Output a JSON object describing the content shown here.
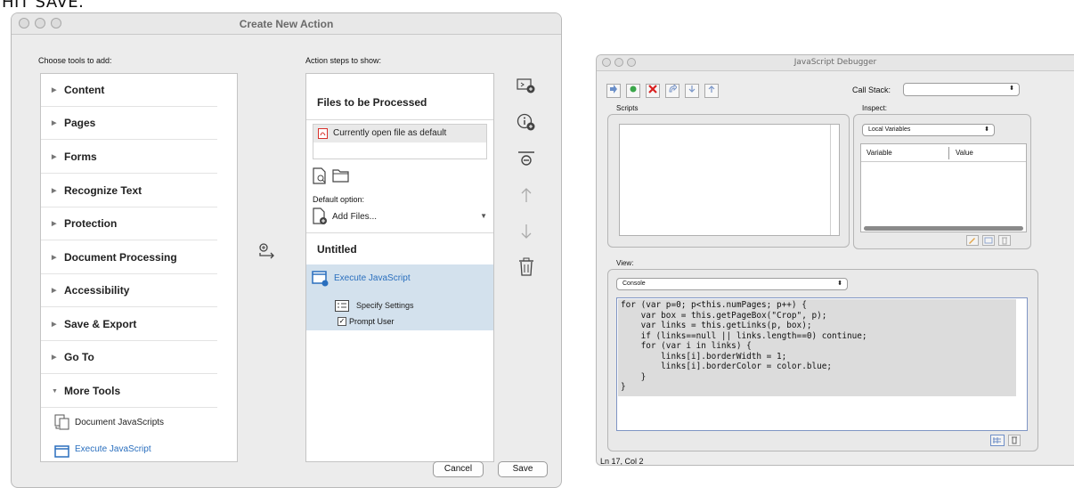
{
  "caption": "HIT SAVE.",
  "create_action": {
    "title": "Create New Action",
    "choose_label": "Choose tools to add:",
    "steps_label": "Action steps to show:",
    "tools": [
      "Content",
      "Pages",
      "Forms",
      "Recognize Text",
      "Protection",
      "Document Processing",
      "Accessibility",
      "Save & Export",
      "Go To",
      "More Tools"
    ],
    "more_tools_items": [
      "Document JavaScripts",
      "Execute JavaScript"
    ],
    "files_section": "Files to be Processed",
    "current_file": "Currently open file as default",
    "default_option_label": "Default option:",
    "add_files": "Add Files...",
    "untitled_section": "Untitled",
    "execute_js": "Execute JavaScript",
    "specify_settings": "Specify Settings",
    "prompt_user": "Prompt User",
    "cancel": "Cancel",
    "save": "Save"
  },
  "debugger": {
    "title": "JavaScript Debugger",
    "call_stack_label": "Call Stack:",
    "scripts_label": "Scripts",
    "inspect_label": "Inspect:",
    "inspect_select": "Local Variables",
    "col_variable": "Variable",
    "col_value": "Value",
    "view_label": "View:",
    "view_select": "Console",
    "code": "for (var p=0; p<this.numPages; p++) {\n    var box = this.getPageBox(\"Crop\", p);\n    var links = this.getLinks(p, box);\n    if (links==null || links.length==0) continue;\n    for (var i in links) {\n        links[i].borderWidth = 1;\n        links[i].borderColor = color.blue;\n    }\n}",
    "status": "Ln 17, Col 2"
  },
  "colors": {
    "accent_blue": "#2a6fbe",
    "pdf_red": "#d9312b",
    "selection": "#d3e1ed"
  },
  "icons": [
    "next-file-icon",
    "info-add-icon",
    "stop-icon",
    "move-up-icon",
    "move-down-icon",
    "trash-icon",
    "add-action-icon"
  ]
}
